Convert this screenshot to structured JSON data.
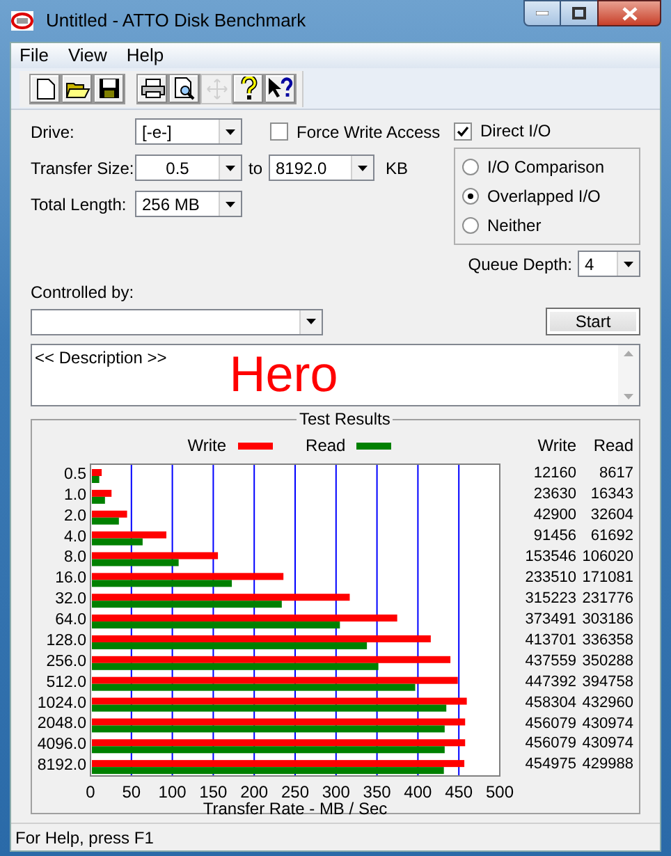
{
  "window": {
    "title": "Untitled - ATTO Disk Benchmark"
  },
  "menu": [
    "File",
    "View",
    "Help"
  ],
  "toolbar": [
    {
      "kind": "new",
      "disabled": false
    },
    {
      "kind": "open",
      "disabled": false
    },
    {
      "kind": "save",
      "disabled": false
    },
    {
      "kind": "print",
      "disabled": false
    },
    {
      "kind": "preview",
      "disabled": false
    },
    {
      "kind": "move",
      "disabled": true
    },
    {
      "kind": "help",
      "disabled": false
    },
    {
      "kind": "context_help",
      "disabled": false
    }
  ],
  "settings": {
    "drive": {
      "label": "Drive:",
      "value": "[-e-]"
    },
    "transfer_size": {
      "label": "Transfer Size:",
      "from": "0.5",
      "to_label": "to",
      "to": "8192.0",
      "unit": "KB"
    },
    "total_length": {
      "label": "Total Length:",
      "value": "256 MB"
    },
    "force_write_access": {
      "label": "Force Write Access",
      "checked": false
    },
    "direct_io": {
      "label": "Direct I/O",
      "checked": true
    },
    "io_modes": [
      {
        "label": "I/O Comparison",
        "selected": false
      },
      {
        "label": "Overlapped I/O",
        "selected": true
      },
      {
        "label": "Neither",
        "selected": false
      }
    ],
    "queue_depth": {
      "label": "Queue Depth:",
      "value": "4"
    },
    "controlled_by": {
      "label": "Controlled by:"
    },
    "start_button": "Start"
  },
  "description": {
    "value": "<< Description >>",
    "overlay_label": "Hero"
  },
  "test_results": {
    "chart_data": {
      "type": "bar",
      "orientation": "horizontal",
      "grid": true,
      "title": "Test Results",
      "xlabel": "Transfer Rate - MB / Sec",
      "categories": [
        "0.5",
        "1.0",
        "2.0",
        "4.0",
        "8.0",
        "16.0",
        "32.0",
        "64.0",
        "128.0",
        "256.0",
        "512.0",
        "1024.0",
        "2048.0",
        "4096.0",
        "8192.0"
      ],
      "xlim": [
        0,
        500
      ],
      "xticks": [
        0,
        50,
        100,
        150,
        200,
        250,
        300,
        350,
        400,
        450,
        500
      ],
      "series": [
        {
          "name": "Write",
          "color": "#ff0000",
          "values": [
            12,
            24,
            43,
            91,
            154,
            234,
            315,
            373,
            414,
            438,
            447,
            458,
            456,
            456,
            455
          ]
        },
        {
          "name": "Read",
          "color": "#008000",
          "values": [
            9,
            16,
            33,
            62,
            106,
            171,
            232,
            303,
            336,
            350,
            395,
            433,
            431,
            431,
            430
          ]
        }
      ]
    },
    "table": {
      "columns": [
        "Write",
        "Read"
      ],
      "rows": [
        [
          "12160",
          "8617"
        ],
        [
          "23630",
          "16343"
        ],
        [
          "42900",
          "32604"
        ],
        [
          "91456",
          "61692"
        ],
        [
          "153546",
          "106020"
        ],
        [
          "233510",
          "171081"
        ],
        [
          "315223",
          "231776"
        ],
        [
          "373491",
          "303186"
        ],
        [
          "413701",
          "336358"
        ],
        [
          "437559",
          "350288"
        ],
        [
          "447392",
          "394758"
        ],
        [
          "458304",
          "432960"
        ],
        [
          "456079",
          "430974"
        ],
        [
          "456079",
          "430974"
        ],
        [
          "454975",
          "429988"
        ]
      ]
    }
  },
  "status_bar": "For Help, press F1"
}
